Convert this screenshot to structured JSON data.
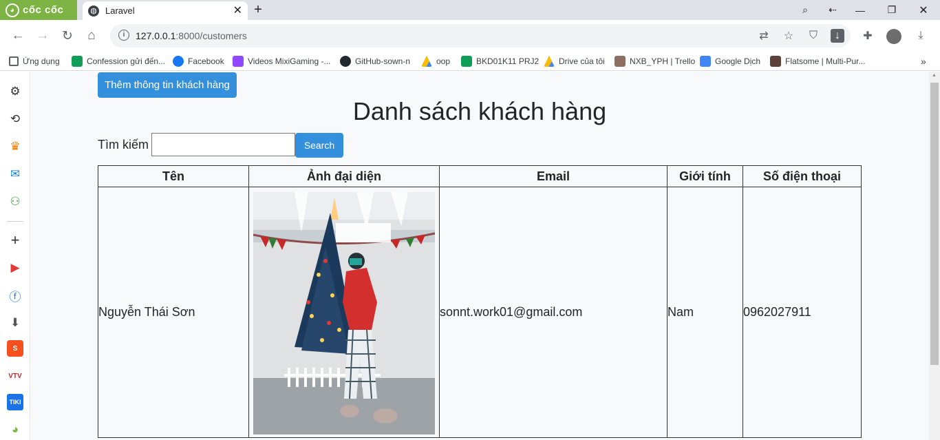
{
  "browser": {
    "brand": "cốc cốc",
    "tab": {
      "title": "Laravel",
      "close": "✕"
    },
    "new_tab": "+",
    "url_host": "127.0.0.1",
    "url_rest": ":8000/customers"
  },
  "bookmarks": [
    {
      "label": "Ứng dụng",
      "icon": "apps-grid-icon",
      "color": "#5f6368"
    },
    {
      "label": "Confession gửi đến...",
      "icon": "sheets-icon",
      "color": "#0f9d58"
    },
    {
      "label": "Facebook",
      "icon": "facebook-icon",
      "color": "#1877f2"
    },
    {
      "label": "Videos MixiGaming -...",
      "icon": "twitch-icon",
      "color": "#9146ff"
    },
    {
      "label": "GitHub-sown-n",
      "icon": "github-icon",
      "color": "#24292e"
    },
    {
      "label": "oop",
      "icon": "drive-icon",
      "color": "#fbbc04"
    },
    {
      "label": "BKD01K11 PRJ2",
      "icon": "sheets-icon",
      "color": "#0f9d58"
    },
    {
      "label": "Drive của tôi",
      "icon": "drive-icon",
      "color": "#fbbc04"
    },
    {
      "label": "NXB_YPH | Trello",
      "icon": "trello-icon",
      "color": "#8d6e63"
    },
    {
      "label": "Google Dịch",
      "icon": "translate-icon",
      "color": "#4285f4"
    },
    {
      "label": "Flatsome | Multi-Pur...",
      "icon": "flatsome-icon",
      "color": "#5d4037"
    }
  ],
  "page": {
    "add_button": "Thêm thông tin khách hàng",
    "title": "Danh sách khách hàng",
    "search_label": "Tìm kiếm",
    "search_value": "",
    "search_button": "Search"
  },
  "table": {
    "headers": [
      "Tên",
      "Ảnh đại diện",
      "Email",
      "Giới tính",
      "Số điện thoại"
    ],
    "rows": [
      {
        "name": "Nguyễn Thái Sơn",
        "email": "sonnt.work01@gmail.com",
        "gender": "Nam",
        "phone": "0962027911"
      }
    ]
  },
  "colors": {
    "primary": "#3490dc",
    "brand": "#7cb342"
  }
}
